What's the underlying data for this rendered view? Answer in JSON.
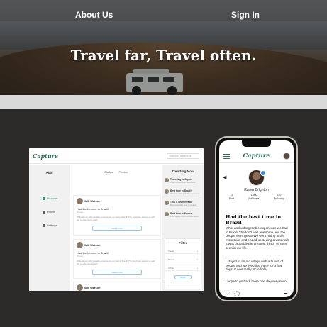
{
  "nav": {
    "about": "About Us",
    "signin": "Sign In"
  },
  "hero": {
    "title": "Travel far, Travel often."
  },
  "desktop": {
    "brand": "Capture",
    "search_placeholder": "Search or adventure",
    "user_name": "Abbi",
    "menu": [
      {
        "label": "Discover",
        "icon": "compass-icon"
      },
      {
        "label": "Profile",
        "icon": "user-icon"
      },
      {
        "label": "Settings",
        "icon": "gear-icon"
      }
    ],
    "tabs": [
      "Stories",
      "Photos"
    ],
    "posts": [
      {
        "author": "Will Watson",
        "title": "Had the heroine in Brazil!",
        "date": "2h ago",
        "body": "Write about unforgettable experience we had in Brazil! The food was awesome and the people were great!",
        "button": "Read more"
      },
      {
        "author": "Will Watson",
        "title": "Had the heroine in Brazil!",
        "date": "2h ago",
        "body": "Write about unforgettable experience we had in Brazil! The food was awesome and the people were great!",
        "button": "Read more"
      },
      {
        "author": "Will Watson"
      }
    ],
    "trending_title": "Trending Now",
    "trending": [
      {
        "title": "Travelling to Japan!",
        "sub": "5 tips to plan your adventure"
      },
      {
        "title": "Best time in Brazil!",
        "sub": "What an unforgettable experience"
      },
      {
        "title": "This is unbelievable",
        "sub": "Best waterfalls ever in Iceland"
      },
      {
        "title": "First time in France",
        "sub": "Paris is the most romantic place"
      }
    ],
    "filter": {
      "title": "Filter",
      "rows": [
        "Travel",
        "Beach",
        "Urban"
      ],
      "button": "Apply"
    }
  },
  "phone": {
    "brand": "Capture",
    "profile_name": "Karen Brighton",
    "stats": [
      {
        "value": "14",
        "label": "Post"
      },
      {
        "value": "1,600",
        "label": "Followers"
      },
      {
        "value": "530",
        "label": "Following"
      }
    ],
    "post_title": "Had the best time in Brazil",
    "para1": "What and unforgettable experience we had in Brazil! The food was awesome and the people were great! We went hiking in the mountains and ended up seeing a waterfall! It was probably the greatest thing I've ever seen in my life.",
    "para2": "I stayed in an old village with a bunch of people and we lived like there for a few days. It was really incredible!",
    "para3": "I hope to go back there one day very soon!"
  }
}
